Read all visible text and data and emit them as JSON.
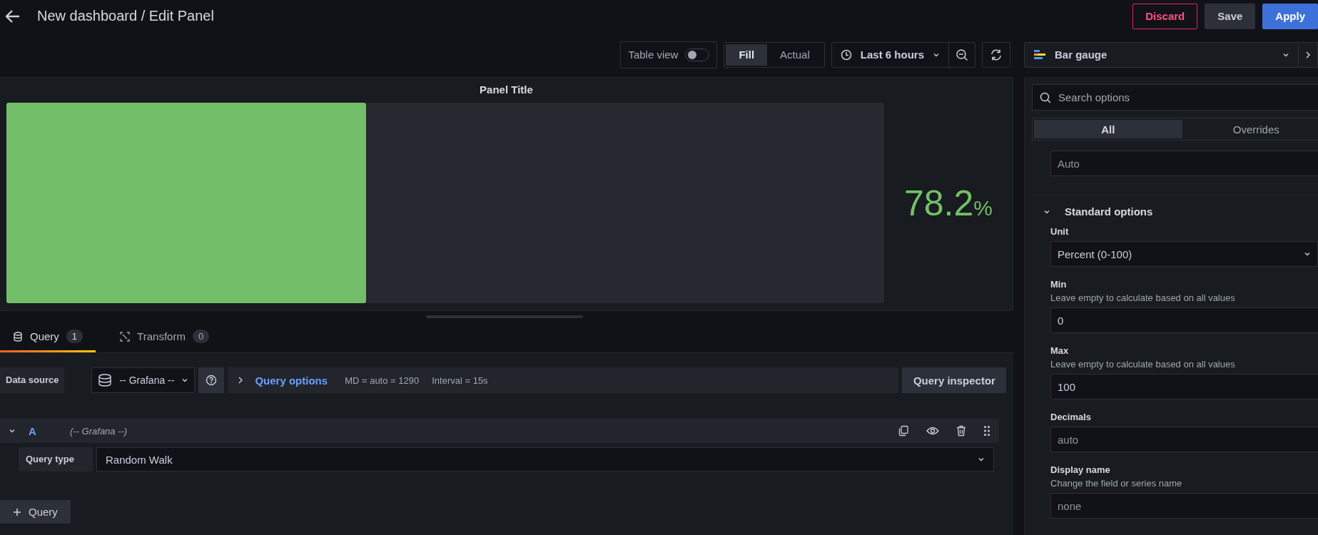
{
  "header": {
    "title": "New dashboard / Edit Panel",
    "buttons": [
      {
        "label": "Discard",
        "kind": "danger"
      },
      {
        "label": "Save",
        "kind": "secondary"
      },
      {
        "label": "Apply",
        "kind": "primary"
      }
    ]
  },
  "toolbar": {
    "table_view": {
      "label": "Table view",
      "on": false
    },
    "size_modes": [
      {
        "label": "Fill",
        "selected": true
      },
      {
        "label": "Actual",
        "selected": false
      }
    ],
    "time_range": "Last 6 hours"
  },
  "panel": {
    "title": "Panel Title",
    "gauge": {
      "level": 0.41,
      "value": "78.2",
      "unit": "%"
    }
  },
  "query_tabs": [
    {
      "label": "Query",
      "count": "1",
      "selected": true
    },
    {
      "label": "Transform",
      "count": "0",
      "selected": false
    }
  ],
  "data_source": {
    "label": "Data source",
    "value": "-- Grafana --"
  },
  "query_options": {
    "label": "Query options",
    "md": "MD = auto = 1290",
    "interval": "Interval = 15s"
  },
  "query_inspector": "Query inspector",
  "queries": [
    {
      "ref": "A",
      "source": "(-- Grafana --)",
      "expanded": true,
      "query_type_label": "Query type",
      "query_type": "Random Walk"
    }
  ],
  "add_query": "Query",
  "options": {
    "visualization": "Bar gauge",
    "search_placeholder": "Search options",
    "tabs": [
      {
        "label": "All",
        "selected": true
      },
      {
        "label": "Overrides",
        "selected": false
      }
    ],
    "top_field": {
      "placeholder": "Auto"
    },
    "section": {
      "title": "Standard options",
      "expanded": true
    },
    "fields": [
      {
        "label": "Unit",
        "kind": "select",
        "value": "Percent (0-100)"
      },
      {
        "label": "Min",
        "description": "Leave empty to calculate based on all values",
        "kind": "input",
        "value": "0"
      },
      {
        "label": "Max",
        "description": "Leave empty to calculate based on all values",
        "kind": "input",
        "value": "100"
      },
      {
        "label": "Decimals",
        "kind": "input",
        "placeholder": "auto"
      },
      {
        "label": "Display name",
        "description": "Change the field or series name",
        "kind": "input",
        "placeholder": "none"
      }
    ]
  }
}
